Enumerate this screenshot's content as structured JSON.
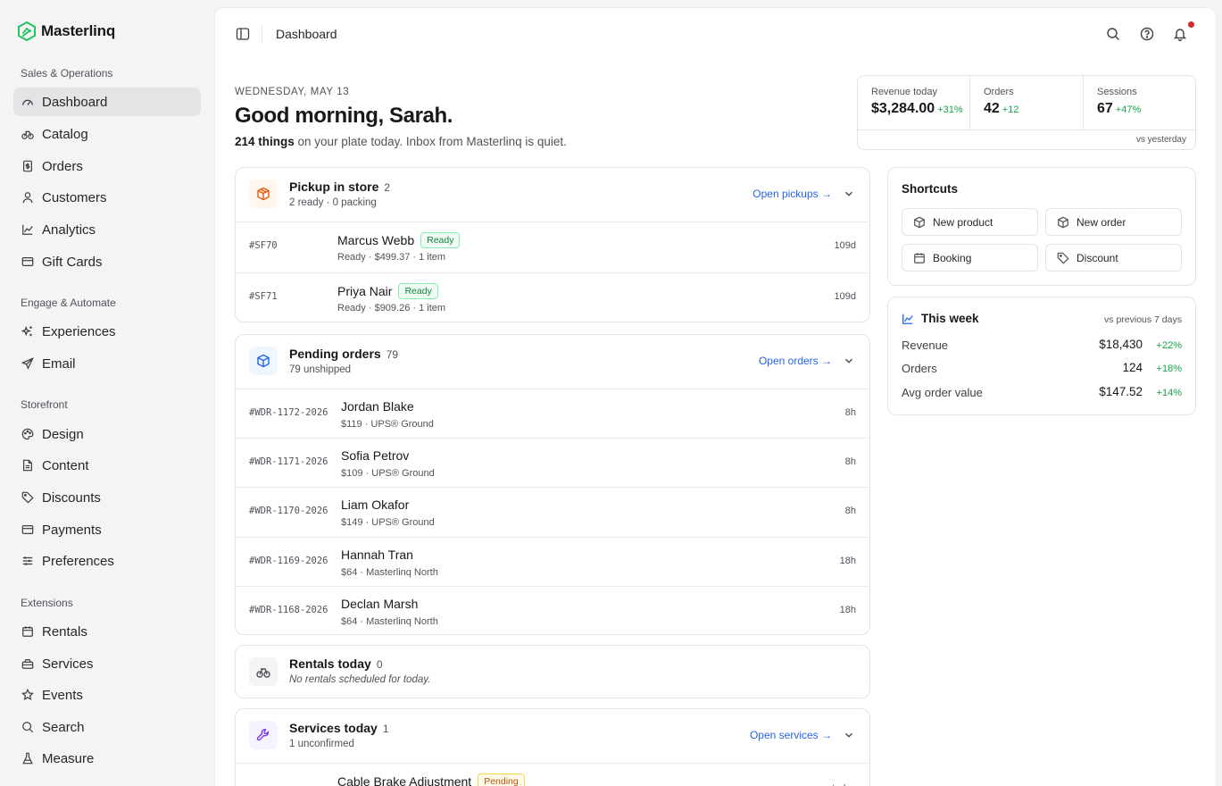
{
  "brand": {
    "name": "Masterlinq",
    "color": "#22c55e"
  },
  "sidebar": {
    "groups": [
      {
        "title": "Sales & Operations",
        "items": [
          {
            "label": "Dashboard",
            "icon": "gauge-icon",
            "active": true
          },
          {
            "label": "Catalog",
            "icon": "bicycle-icon"
          },
          {
            "label": "Orders",
            "icon": "receipt-icon"
          },
          {
            "label": "Customers",
            "icon": "user-icon"
          },
          {
            "label": "Analytics",
            "icon": "chart-line-icon"
          },
          {
            "label": "Gift Cards",
            "icon": "credit-card-icon"
          }
        ]
      },
      {
        "title": "Engage & Automate",
        "items": [
          {
            "label": "Experiences",
            "icon": "sparkles-icon"
          },
          {
            "label": "Email",
            "icon": "send-icon"
          }
        ]
      },
      {
        "title": "Storefront",
        "items": [
          {
            "label": "Design",
            "icon": "palette-icon"
          },
          {
            "label": "Content",
            "icon": "file-icon"
          },
          {
            "label": "Discounts",
            "icon": "tag-icon"
          },
          {
            "label": "Payments",
            "icon": "credit-card-icon"
          },
          {
            "label": "Preferences",
            "icon": "sliders-icon"
          }
        ]
      },
      {
        "title": "Extensions",
        "items": [
          {
            "label": "Rentals",
            "icon": "calendar-icon"
          },
          {
            "label": "Services",
            "icon": "toolbox-icon"
          },
          {
            "label": "Events",
            "icon": "star-icon"
          },
          {
            "label": "Search",
            "icon": "search-icon"
          },
          {
            "label": "Measure",
            "icon": "flask-icon"
          }
        ]
      }
    ]
  },
  "topbar": {
    "title": "Dashboard"
  },
  "header": {
    "date": "WEDNESDAY, MAY 13",
    "greeting": "Good morning, Sarah.",
    "plate_count": "214 things",
    "plate_rest": " on your plate today. Inbox from Masterlinq is quiet."
  },
  "stats": {
    "items": [
      {
        "label": "Revenue today",
        "value": "$3,284.00",
        "delta": "+31%"
      },
      {
        "label": "Orders",
        "value": "42",
        "delta": "+12"
      },
      {
        "label": "Sessions",
        "value": "67",
        "delta": "+47%"
      }
    ],
    "footnote": "vs yesterday"
  },
  "pickup": {
    "title": "Pickup in store",
    "count": "2",
    "sub": "2 ready · 0 packing",
    "link": "Open pickups →",
    "rows": [
      {
        "id": "#SF70",
        "name": "Marcus Webb",
        "badge": "Ready",
        "sub": "Ready · $499.37 · 1 item",
        "age": "109d"
      },
      {
        "id": "#SF71",
        "name": "Priya Nair",
        "badge": "Ready",
        "sub": "Ready · $909.26 · 1 item",
        "age": "109d"
      }
    ]
  },
  "pending": {
    "title": "Pending orders",
    "count": "79",
    "sub": "79 unshipped",
    "link": "Open orders →",
    "rows": [
      {
        "id": "#WDR-1172-2026",
        "name": "Jordan Blake",
        "sub": "$119 · UPS® Ground",
        "age": "8h"
      },
      {
        "id": "#WDR-1171-2026",
        "name": "Sofia Petrov",
        "sub": "$109 · UPS® Ground",
        "age": "8h"
      },
      {
        "id": "#WDR-1170-2026",
        "name": "Liam Okafor",
        "sub": "$149 · UPS® Ground",
        "age": "8h"
      },
      {
        "id": "#WDR-1169-2026",
        "name": "Hannah Tran",
        "sub": "$64 · Masterlinq North",
        "age": "18h"
      },
      {
        "id": "#WDR-1168-2026",
        "name": "Declan Marsh",
        "sub": "$64 · Masterlinq North",
        "age": "18h"
      }
    ]
  },
  "rentals": {
    "title": "Rentals today",
    "count": "0",
    "sub": "No rentals scheduled for today."
  },
  "services": {
    "title": "Services today",
    "count": "1",
    "sub": "1 unconfirmed",
    "link": "Open services →",
    "rows": [
      {
        "name": "Cable Brake Adjustment",
        "badge": "Pending",
        "age": "today"
      }
    ]
  },
  "shortcuts": {
    "title": "Shortcuts",
    "items": [
      {
        "label": "New product",
        "icon": "box-icon"
      },
      {
        "label": "New order",
        "icon": "box-icon"
      },
      {
        "label": "Booking",
        "icon": "calendar-icon"
      },
      {
        "label": "Discount",
        "icon": "tag-icon"
      }
    ]
  },
  "week": {
    "title": "This week",
    "note": "vs previous 7 days",
    "rows": [
      {
        "label": "Revenue",
        "value": "$18,430",
        "delta": "+22%"
      },
      {
        "label": "Orders",
        "value": "124",
        "delta": "+18%"
      },
      {
        "label": "Avg order value",
        "value": "$147.52",
        "delta": "+14%"
      }
    ]
  }
}
